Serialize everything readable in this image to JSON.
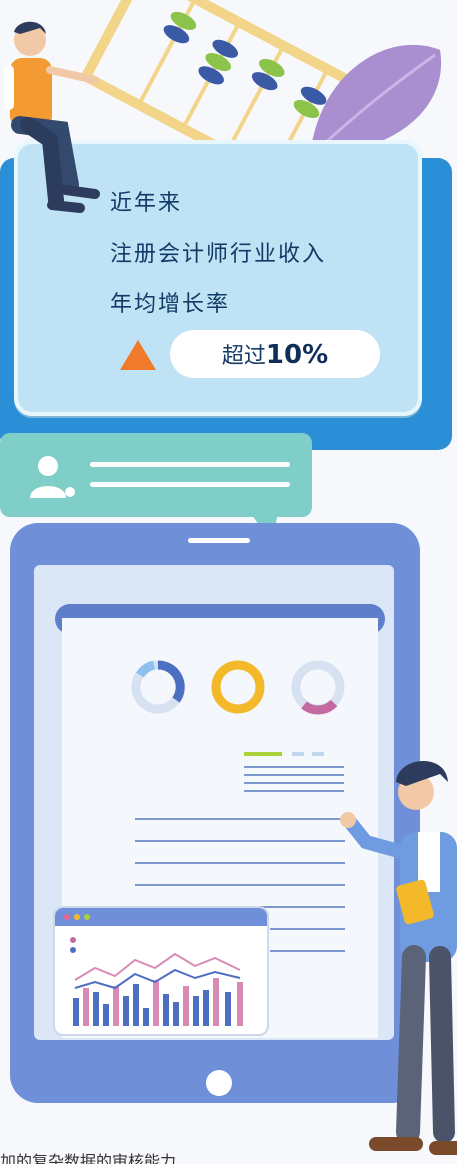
{
  "infographic": {
    "headline_line1": "近年来",
    "headline_line2": "注册会计师行业收入",
    "headline_line3": "年均增长率",
    "stat_prefix": "超过",
    "stat_value": "10%"
  },
  "caption": "加的复杂数据的审核能力",
  "colors": {
    "card": "#bfe3f4",
    "card_back": "#2a8fd6",
    "accent_orange": "#f07a2a",
    "tablet": "#6f8fd9",
    "bubble": "#7fcfc8"
  },
  "icons": [
    "abacus-icon",
    "person-icon",
    "up-triangle-icon",
    "user-icon",
    "donut-chart-icon",
    "bar-chart-icon",
    "document-icon"
  ]
}
